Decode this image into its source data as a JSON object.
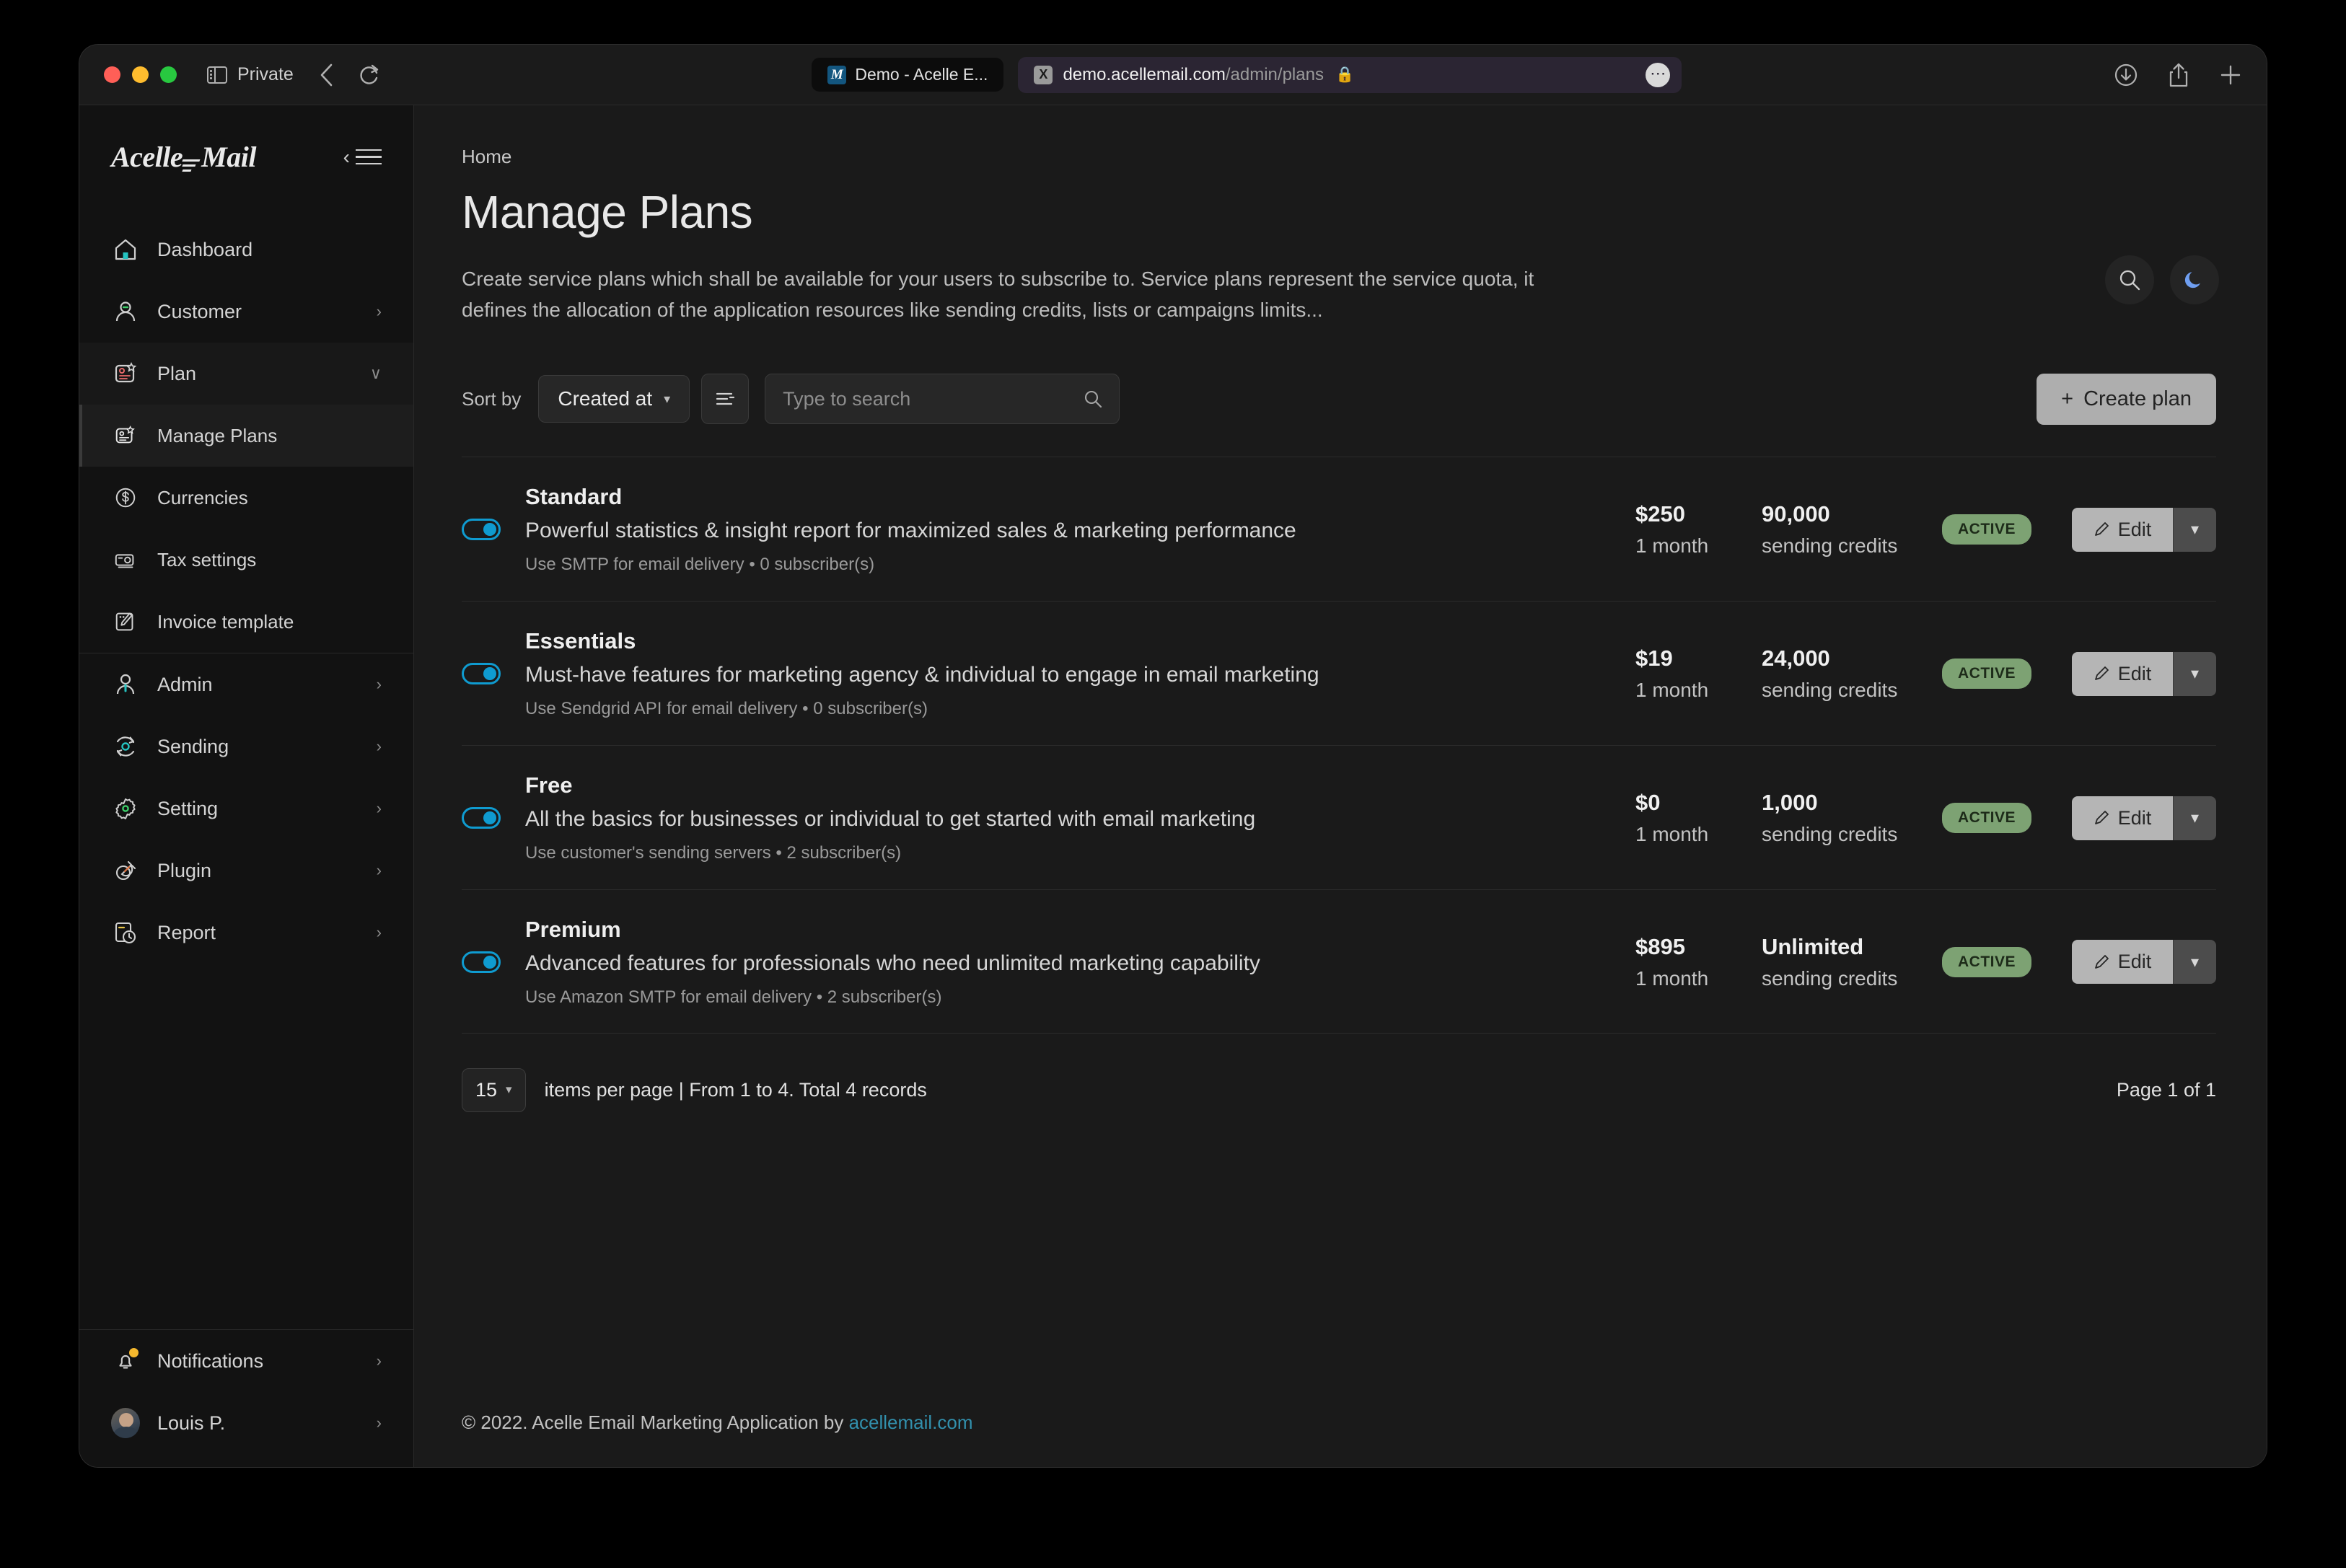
{
  "browser": {
    "private_label": "Private",
    "back_icon": "chevron-left-icon",
    "reload_icon": "reload-icon",
    "sidebar_icon": "sidebar-toggle-icon",
    "tab": {
      "favicon_letter": "M",
      "title": "Demo - Acelle E..."
    },
    "url": {
      "host": "demo.acellemail.com",
      "path": "/admin/plans",
      "blocker_letter": "X",
      "lock_icon": "lock-icon",
      "more_icon": "ellipsis-icon"
    },
    "right_icons": [
      "download-icon",
      "share-icon",
      "new-tab-icon"
    ]
  },
  "sidebar": {
    "logo": {
      "part1": "Acelle",
      "part2": "Mail"
    },
    "collapse_icon": "collapse-sidebar-icon",
    "items": [
      {
        "label": "Dashboard",
        "icon": "home-icon",
        "caret": "",
        "active": false
      },
      {
        "label": "Customer",
        "icon": "user-icon",
        "caret": "›",
        "active": false
      },
      {
        "label": "Plan",
        "icon": "plan-icon",
        "caret": "∨",
        "active": false,
        "expanded": true
      }
    ],
    "sub_items": [
      {
        "label": "Manage Plans",
        "icon": "plan-icon",
        "active": true
      },
      {
        "label": "Currencies",
        "icon": "dollar-circle-icon",
        "active": false
      },
      {
        "label": "Tax settings",
        "icon": "tax-icon",
        "active": false
      },
      {
        "label": "Invoice template",
        "icon": "invoice-template-icon",
        "active": false
      }
    ],
    "items_lower": [
      {
        "label": "Admin",
        "icon": "admin-user-icon",
        "caret": "›"
      },
      {
        "label": "Sending",
        "icon": "sending-sync-icon",
        "caret": "›"
      },
      {
        "label": "Setting",
        "icon": "gear-icon",
        "caret": "›"
      },
      {
        "label": "Plugin",
        "icon": "plugin-icon",
        "caret": "›"
      },
      {
        "label": "Report",
        "icon": "report-clock-icon",
        "caret": "›"
      }
    ],
    "bottom": [
      {
        "label": "Notifications",
        "icon": "bell-icon",
        "caret": "›",
        "badge": true
      },
      {
        "label": "Louis P.",
        "icon": "avatar",
        "caret": "›",
        "badge": false
      }
    ]
  },
  "header": {
    "breadcrumb": "Home",
    "title": "Manage Plans",
    "description": "Create service plans which shall be available for your users to subscribe to. Service plans represent the service quota, it defines the allocation of the application resources like sending credits, lists or campaigns limits...",
    "search_icon": "search-icon",
    "theme_icon": "moon-icon",
    "theme_icon_color": "#6f9ef0"
  },
  "toolbar": {
    "sort_label": "Sort by",
    "sort_value": "Created at",
    "sort_caret": "▾",
    "sort_direction_icon": "sort-order-icon",
    "search_placeholder": "Type to search",
    "search_value": "",
    "search_icon": "search-icon",
    "create_label": "Create plan",
    "create_icon": "plus-icon"
  },
  "plans": [
    {
      "name": "Standard",
      "description": "Powerful statistics & insight report for maximized sales & marketing performance",
      "meta": "Use SMTP for email delivery • 0 subscriber(s)",
      "price": "$250",
      "period": "1 month",
      "credits": "90,000",
      "credits_unit": "sending credits",
      "status": "ACTIVE",
      "edit_label": "Edit",
      "enabled": true
    },
    {
      "name": "Essentials",
      "description": "Must-have features for marketing agency & individual to engage in email marketing",
      "meta": "Use Sendgrid API for email delivery • 0 subscriber(s)",
      "price": "$19",
      "period": "1 month",
      "credits": "24,000",
      "credits_unit": "sending credits",
      "status": "ACTIVE",
      "edit_label": "Edit",
      "enabled": true
    },
    {
      "name": "Free",
      "description": "All the basics for businesses or individual to get started with email marketing",
      "meta": "Use customer's sending servers • 2 subscriber(s)",
      "price": "$0",
      "period": "1 month",
      "credits": "1,000",
      "credits_unit": "sending credits",
      "status": "ACTIVE",
      "edit_label": "Edit",
      "enabled": true
    },
    {
      "name": "Premium",
      "description": "Advanced features for professionals who need unlimited marketing capability",
      "meta": "Use Amazon SMTP for email delivery • 2 subscriber(s)",
      "price": "$895",
      "period": "1 month",
      "credits": "Unlimited",
      "credits_unit": "sending credits",
      "status": "ACTIVE",
      "edit_label": "Edit",
      "enabled": true
    }
  ],
  "pagination": {
    "per_page_value": "15",
    "per_page_caret": "▾",
    "info": "items per page  | From 1 to 4. Total 4 records",
    "page_indicator": "Page 1 of 1"
  },
  "footer": {
    "text": "© 2022. Acelle Email Marketing Application by ",
    "link": "acellemail.com"
  },
  "colors": {
    "accent_toggle": "#0f9bd0",
    "status_active_bg": "#7da273",
    "link": "#3290ad",
    "notification_badge": "#f5b82e"
  }
}
